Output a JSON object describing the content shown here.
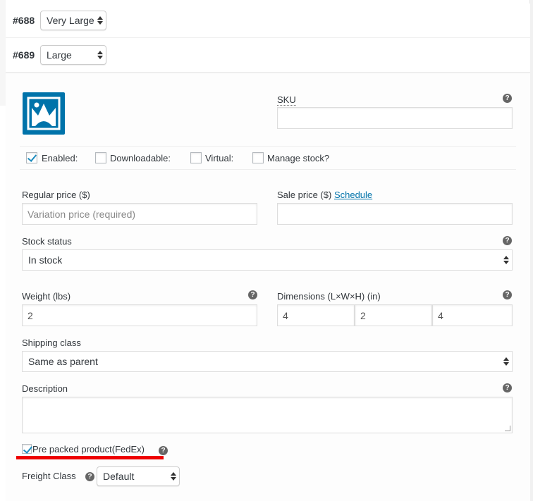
{
  "variations": [
    {
      "number": "#688",
      "size": "Very Large"
    },
    {
      "number": "#689",
      "size": "Large"
    }
  ],
  "form": {
    "sku_label": "SKU",
    "checkboxes": [
      {
        "label": "Enabled:",
        "checked": true
      },
      {
        "label": "Downloadable:",
        "checked": false
      },
      {
        "label": "Virtual:",
        "checked": false
      },
      {
        "label": "Manage stock?",
        "checked": false
      }
    ],
    "regular_price_label": "Regular price ($)",
    "regular_price_placeholder": "Variation price (required)",
    "sale_price_label": "Sale price ($)",
    "schedule_link": "Schedule",
    "stock_status_label": "Stock status",
    "stock_status_value": "In stock",
    "weight_label": "Weight (lbs)",
    "weight_value": "2",
    "dimensions_label": "Dimensions (L×W×H) (in)",
    "dim_length": "4",
    "dim_width": "2",
    "dim_height": "4",
    "shipping_class_label": "Shipping class",
    "shipping_class_value": "Same as parent",
    "description_label": "Description",
    "prepacked_label": "Pre packed product(FedEx)",
    "prepacked_checked": true,
    "freight_class_label": "Freight Class",
    "freight_class_value": "Default"
  },
  "help_icon_glyph": "?",
  "colors": {
    "accent": "#0073aa",
    "highlight": "#e00000"
  }
}
